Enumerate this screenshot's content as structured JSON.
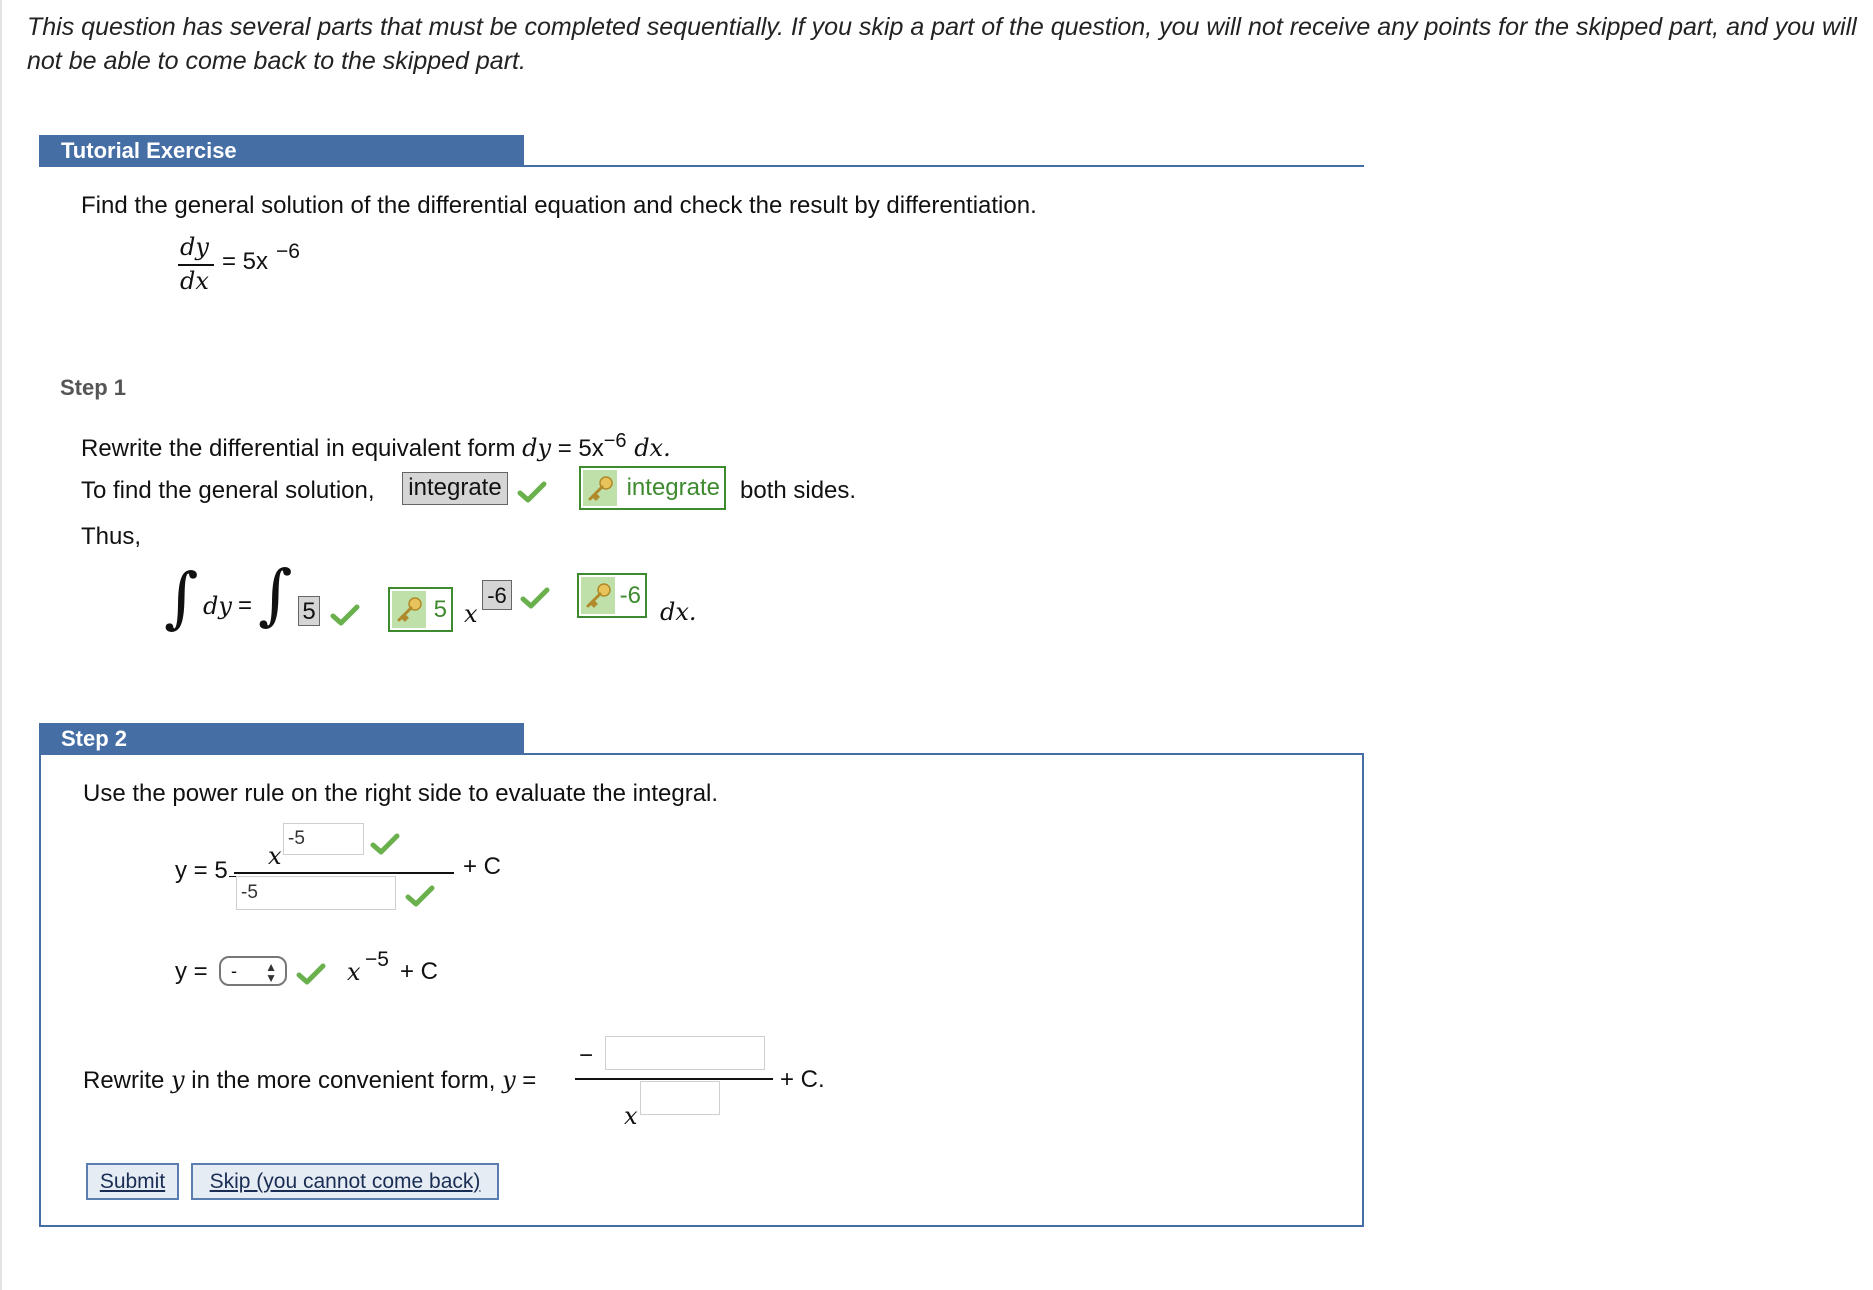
{
  "notice": "This question has several parts that must be completed sequentially. If you skip a part of the question, you will not receive any points for the skipped part, and you will not be able to come back to the skipped part.",
  "tutorial": {
    "header": "Tutorial Exercise",
    "instruction": "Find the general solution of the differential equation and check the result by differentiation.",
    "equation": {
      "num": "dy",
      "den": "dx",
      "rhs": "= 5x",
      "exp": "−6"
    }
  },
  "step1": {
    "label": "Step 1",
    "line1": {
      "pre": "Rewrite the differential in equivalent form ",
      "dy": "dy",
      "eq": " = 5x",
      "exp": "−6",
      "dx": " dx."
    },
    "line2": {
      "pre": "To find the general solution,",
      "answer": "integrate",
      "key": "integrate",
      "post": "both sides."
    },
    "line3": "Thus,",
    "integral": {
      "dy": "dy",
      "eq": "=",
      "coef_answer": "5",
      "coef_key": "5",
      "x": "x",
      "exp_answer": "-6",
      "exp_key": "-6",
      "dx": "dx."
    }
  },
  "step2": {
    "header": "Step 2",
    "instruction": "Use the power rule on the right side to evaluate the integral.",
    "frac": {
      "lhs": "y = 5",
      "num_exp": "-5",
      "x": "x",
      "den": "-5",
      "plus_c": "+ C"
    },
    "select_row": {
      "lhs": "y =",
      "selected": "-",
      "x": "x",
      "exp": "−5",
      "plus_c": "+ C"
    },
    "rewrite": {
      "pre": "Rewrite ",
      "y": "y",
      "mid": " in the more convenient form, ",
      "y2": "y",
      "eq": " =",
      "minus": "−",
      "x": "x",
      "num": "",
      "den": "",
      "plus_c": "+ C."
    },
    "submit": "Submit",
    "skip": "Skip (you cannot come back)"
  },
  "colors": {
    "header_blue": "#456ea5",
    "correct_green": "#6ab04c",
    "key_green": "#3d8a2f"
  }
}
